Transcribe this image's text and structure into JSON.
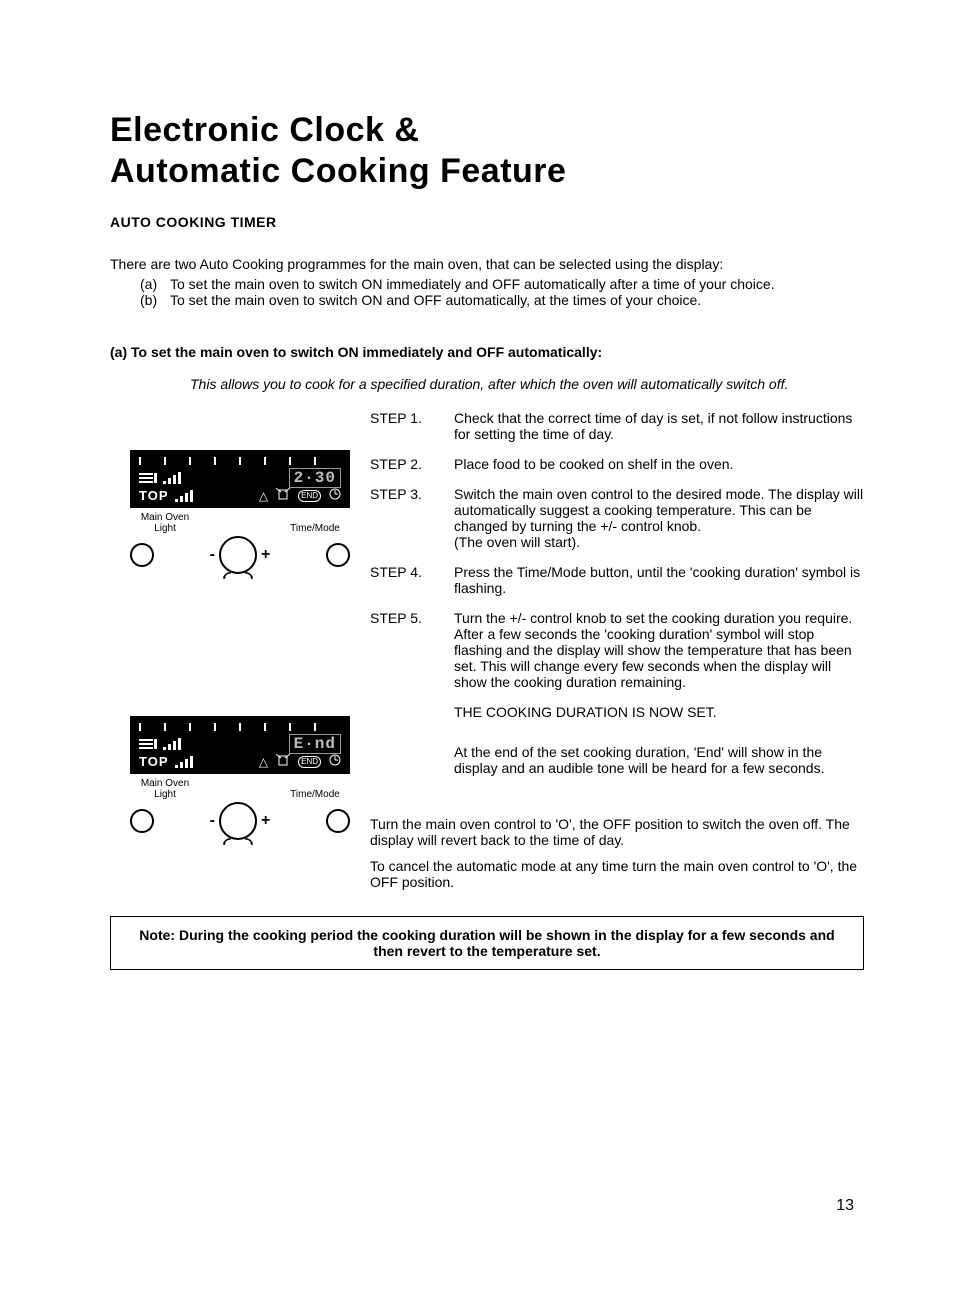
{
  "title_line1": "Electronic Clock &",
  "title_line2": "Automatic Cooking Feature",
  "subheading": "AUTO COOKING TIMER",
  "intro": "There are two Auto Cooking programmes for the main oven, that can be selected using the display:",
  "options": [
    {
      "marker": "(a)",
      "text": "To set the main oven to switch ON immediately and OFF automatically after a time of your choice."
    },
    {
      "marker": "(b)",
      "text": "To set the main oven to switch ON and OFF automatically, at the times of your choice."
    }
  ],
  "section_a_heading": "(a)  To set the main oven to switch ON immediately and OFF automatically:",
  "section_a_italic": "This allows you to cook for a specified duration, after which the oven will automatically switch off.",
  "steps": [
    {
      "label": "STEP 1.",
      "body": "Check that the correct time of day is set, if not follow instructions for setting the time of day."
    },
    {
      "label": "STEP 2.",
      "body": "Place food to be cooked on shelf in the oven."
    },
    {
      "label": "STEP 3.",
      "body": "Switch the main oven control to the desired mode. The display will automatically suggest a cooking temperature. This can be changed by turning the +/- control knob.\n(The oven will start)."
    },
    {
      "label": "STEP 4.",
      "body": "Press the Time/Mode button, until the 'cooking duration' symbol is flashing."
    },
    {
      "label": "STEP 5.",
      "body": "Turn the +/- control knob to set the cooking duration you require.  After a few seconds the 'cooking duration' symbol will stop flashing and the display will show the temperature that has been set. This will change every few seconds when the display will show the cooking duration remaining."
    }
  ],
  "after_steps": [
    "THE COOKING DURATION IS NOW SET.",
    "At the end of the set cooking duration, 'End' will show in the display and an audible tone will be heard for a few seconds."
  ],
  "closing": [
    "Turn the main oven control to 'O', the OFF position to switch the oven off. The display will revert back to the time of day.",
    "To cancel the automatic mode at any time turn the main oven control to 'O', the OFF position."
  ],
  "note": "Note: During the cooking period the cooking duration will be shown in the display for a few seconds and then revert to the temperature set.",
  "page_number": "13",
  "panels": [
    {
      "digits": "2·30",
      "top_label": "TOP",
      "ctrl_left": "Main Oven\nLight",
      "ctrl_right": "Time/Mode",
      "minus": "-",
      "plus": "+",
      "end_icon": "END"
    },
    {
      "digits": "E·nd",
      "top_label": "TOP",
      "ctrl_left": "Main Oven\nLight",
      "ctrl_right": "Time/Mode",
      "minus": "-",
      "plus": "+",
      "end_icon": "END"
    }
  ]
}
